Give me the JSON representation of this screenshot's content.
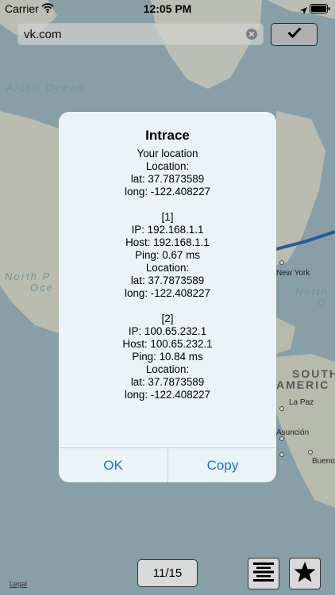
{
  "status_bar": {
    "carrier": "Carrier",
    "time": "12:05 PM"
  },
  "search": {
    "value": "vk.com"
  },
  "map": {
    "ocean_labels": {
      "arctic": "Arctic Ocean",
      "north_pacific_1": "North P",
      "north_pacific_2": "Oce",
      "north_atlantic_1": "North",
      "north_atlantic_2": "O"
    },
    "place_labels": {
      "new_york": "New York",
      "la_paz": "La Paz",
      "asuncion": "Asunción",
      "buenos": "Bueno",
      "south": "SOUTH",
      "america": "AMERIC"
    },
    "colors": {
      "land": "#e2e6d6",
      "water": "#a7c3cc",
      "route": "#2f6fb4"
    }
  },
  "alert": {
    "title": "Intrace",
    "message_lines": [
      "Your location",
      "Location:",
      "lat: 37.7873589",
      "long: -122.408227",
      "",
      "[1]",
      "IP: 192.168.1.1",
      "Host: 192.168.1.1",
      "Ping: 0.67 ms",
      "Location:",
      "lat: 37.7873589",
      "long: -122.408227",
      "",
      "[2]",
      "IP: 100.65.232.1",
      "Host: 100.65.232.1",
      "Ping: 10.84 ms",
      "Location:",
      "lat: 37.7873589",
      "long: -122.408227"
    ],
    "ok_label": "OK",
    "copy_label": "Copy",
    "button_color": "#1a6fe0"
  },
  "toolbar": {
    "legal_label": "Legal",
    "page_counter": "11/15",
    "list_icon": "list-icon",
    "star_icon": "star-icon"
  }
}
